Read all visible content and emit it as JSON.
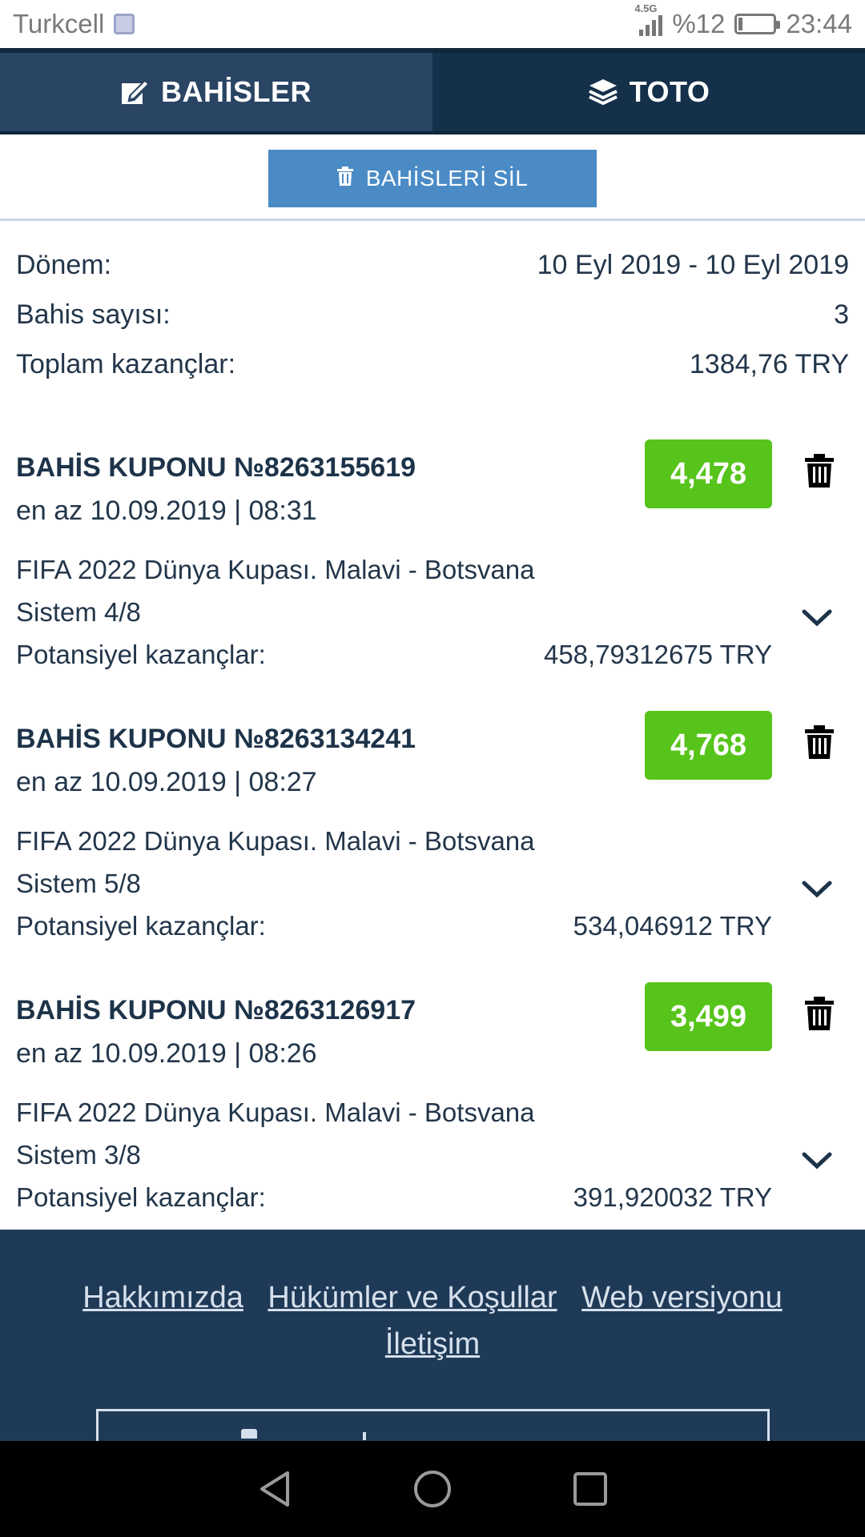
{
  "status_bar": {
    "carrier": "Turkcell",
    "network": "4.5G",
    "battery": "%12",
    "battery_level": 0.12,
    "time": "23:44"
  },
  "tabs": [
    {
      "label": "BAHİSLER",
      "icon": "edit-icon",
      "active": true
    },
    {
      "label": "TOTO",
      "icon": "layers-icon",
      "active": false
    }
  ],
  "delete_all": {
    "label": "BAHİSLERİ SİL",
    "icon": "trash-icon"
  },
  "summary": [
    {
      "label": "Dönem:",
      "value": "10 Eyl 2019 - 10 Eyl 2019"
    },
    {
      "label": "Bahis sayısı:",
      "value": "3"
    },
    {
      "label": "Toplam kazançlar:",
      "value": "1384,76 TRY"
    }
  ],
  "coupons": [
    {
      "title": "BAHİS KUPONU №8263155619",
      "date": "en az 10.09.2019 | 08:31",
      "odds": "4,478",
      "event": "FIFA 2022 Dünya Kupası. Malavi - Botsvana",
      "system": "Sistem 4/8",
      "potential_label": "Potansiyel kazançlar:",
      "potential_value": "458,79312675 TRY"
    },
    {
      "title": "BAHİS KUPONU №8263134241",
      "date": "en az 10.09.2019 | 08:27",
      "odds": "4,768",
      "event": "FIFA 2022 Dünya Kupası. Malavi - Botsvana",
      "system": "Sistem 5/8",
      "potential_label": "Potansiyel kazançlar:",
      "potential_value": "534,046912 TRY"
    },
    {
      "title": "BAHİS KUPONU №8263126917",
      "date": "en az 10.09.2019 | 08:26",
      "odds": "3,499",
      "event": "FIFA 2022 Dünya Kupası. Malavi - Botsvana",
      "system": "Sistem 3/8",
      "potential_label": "Potansiyel kazançlar:",
      "potential_value": "391,920032 TRY"
    }
  ],
  "footer": {
    "links": [
      "Hakkımızda",
      "Hükümler ve Koşullar",
      "Web versiyonu",
      "İletişim"
    ]
  },
  "colors": {
    "navy": "#1d3349",
    "tab_active": "#2a4463",
    "button_blue": "#4a8bc6",
    "odds_green": "#57c41b",
    "footer_bg": "#1f3a57"
  }
}
